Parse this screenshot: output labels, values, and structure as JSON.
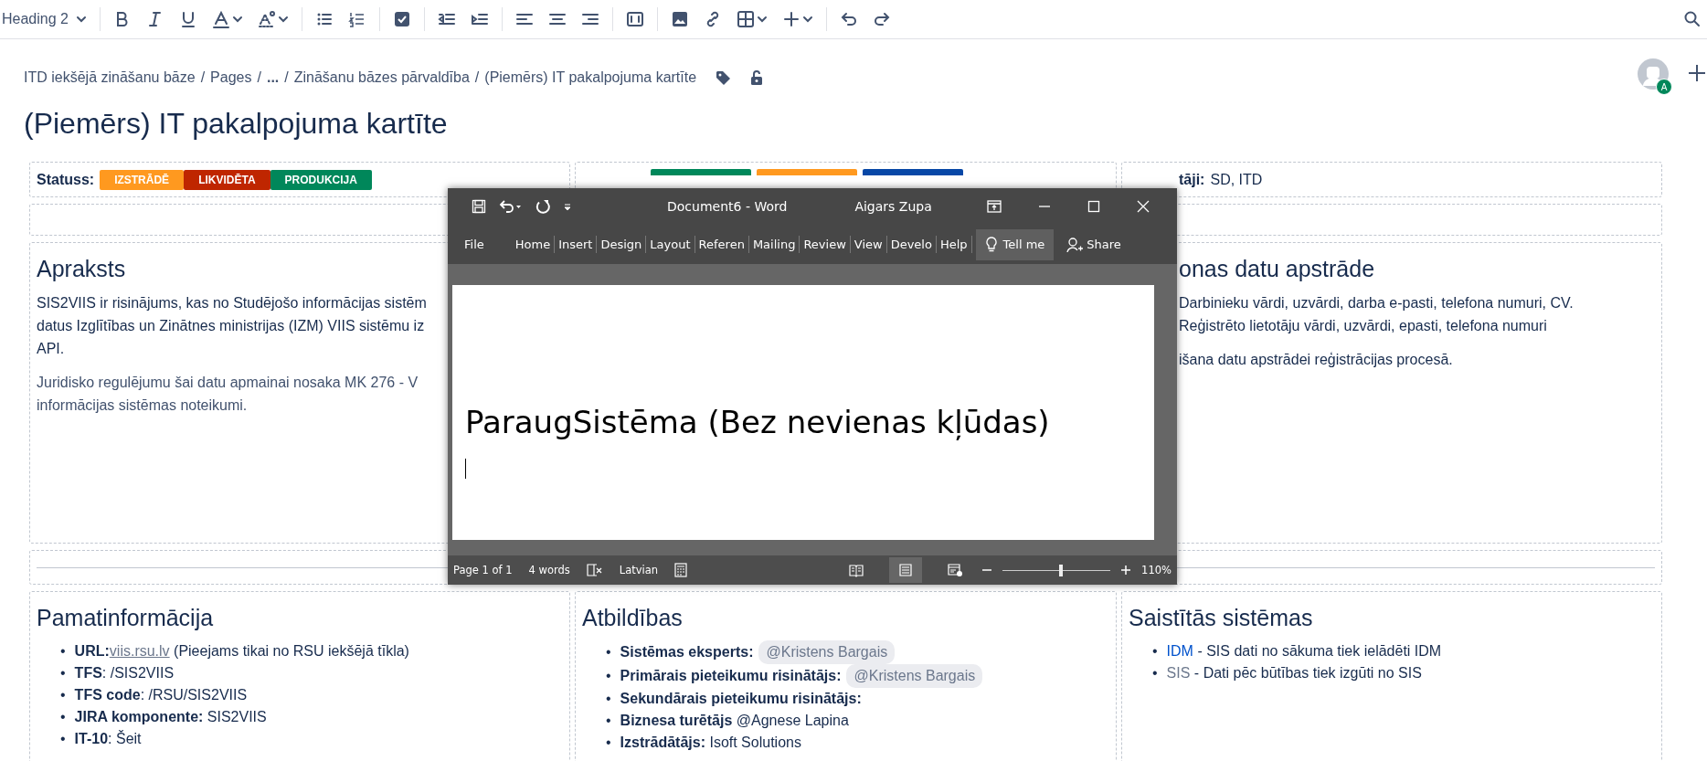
{
  "toolbar": {
    "text_style": "Heading 2",
    "items": [
      {
        "kind": "bold"
      },
      {
        "kind": "italic"
      },
      {
        "kind": "underline"
      },
      {
        "kind": "text-color"
      },
      {
        "kind": "format"
      },
      {
        "kind": "separator"
      },
      {
        "kind": "bullets"
      },
      {
        "kind": "numbers"
      },
      {
        "kind": "separator"
      },
      {
        "kind": "task"
      },
      {
        "kind": "separator"
      },
      {
        "kind": "outdent"
      },
      {
        "kind": "indent"
      },
      {
        "kind": "separator"
      },
      {
        "kind": "align-left"
      },
      {
        "kind": "align-center"
      },
      {
        "kind": "align-right"
      },
      {
        "kind": "separator"
      },
      {
        "kind": "layout"
      },
      {
        "kind": "separator"
      },
      {
        "kind": "image"
      },
      {
        "kind": "link"
      },
      {
        "kind": "table"
      },
      {
        "kind": "insert"
      },
      {
        "kind": "separator"
      },
      {
        "kind": "undo"
      },
      {
        "kind": "redo"
      }
    ]
  },
  "breadcrumb": {
    "separator": "/",
    "items": [
      "ITD iekšējā zināšanu bāze",
      "Pages",
      "...",
      "Zināšanu bāzes pārvaldība",
      "(Piemērs) IT pakalpojuma kartīte"
    ]
  },
  "avatar": {
    "badge": "A"
  },
  "title": "(Piemērs) IT pakalpojuma kartīte",
  "status_row": {
    "label": "Statuss:",
    "badges": [
      {
        "text": "IZSTRĀDĒ",
        "color": "#ff991f"
      },
      {
        "text": "LIKVIDĒTA",
        "color": "#bf2600"
      },
      {
        "text": "PRODUKCIJA",
        "color": "#00875a"
      }
    ],
    "partial_badges": [
      {
        "color": "#00875a"
      },
      {
        "color": "#ff991f"
      },
      {
        "color": "#0747a6"
      }
    ],
    "right_label": "tāji:",
    "right_value": "SD, ITD"
  },
  "description": {
    "heading": "Apraksts",
    "lines": [
      "SIS2VIIS ir risinājums, kas no Studējošo informācijas sistēm",
      "datus Izglītības un Zinātnes ministrijas (IZM) VIIS sistēmu iz",
      "API."
    ],
    "law_lines": [
      "Juridisko regulējumu šai datu apmainai nosaka MK 276 - V",
      "informācijas sistēmas noteikumi."
    ]
  },
  "data_processing": {
    "heading": "onas datu apstrāde",
    "lines": [
      "Darbinieku vārdi, uzvārdi, darba e-pasti, telefona numuri, CV.",
      "Reģistrēto lietotāju vārdi, uzvārdi, epasti, telefona numuri"
    ],
    "note": "išana datu apstrādei reģistrācijas procesā."
  },
  "bullet": "•",
  "basic_info": {
    "heading": "Pamatinformācija",
    "items": [
      {
        "label": "URL:",
        "link": "viis.rsu.lv",
        "text": " (Pieejams tikai no RSU iekšējā tīkla)"
      },
      {
        "label": "TFS",
        "text": ": /SIS2VIIS"
      },
      {
        "label": "TFS code",
        "text": ": /RSU/SIS2VIIS"
      },
      {
        "label": "JIRA komponente:",
        "text": " SIS2VIIS"
      },
      {
        "label": "IT-10",
        "text": ": Šeit"
      }
    ]
  },
  "responsibilities": {
    "heading": "Atbildības",
    "items": [
      {
        "label": "Sistēmas eksperts:",
        "mention": "@Kristens Bargais"
      },
      {
        "label": "Primārais pieteikumu risinātājs:",
        "mention": "@Kristens Bargais"
      },
      {
        "label": "Sekundārais pieteikumu risinātājs:"
      },
      {
        "label": "Biznesa turētājs",
        "text": " @Agnese Lapina"
      },
      {
        "label": "Izstrādātājs:",
        "text": " Isoft Solutions"
      }
    ]
  },
  "related_systems": {
    "heading": "Saistītās sistēmas",
    "items": [
      {
        "link": "IDM",
        "text": " - SIS dati no sākuma tiek ielādēti IDM"
      },
      {
        "link": "SIS",
        "text": " - Dati pēc būtības tiek izgūti no SIS"
      }
    ]
  },
  "word_window": {
    "title": "Document6  -  Word",
    "user": "Aigars Zupa",
    "tabs": [
      {
        "label": "File",
        "selected": false
      },
      {
        "label": "Home",
        "selected": false
      },
      {
        "label": "Insert",
        "selected": false
      },
      {
        "label": "Design",
        "selected": false
      },
      {
        "label": "Layout",
        "selected": false
      },
      {
        "label": "Referen",
        "selected": false
      },
      {
        "label": "Mailing",
        "selected": false
      },
      {
        "label": "Review",
        "selected": false
      },
      {
        "label": "View",
        "selected": false
      },
      {
        "label": "Develo",
        "selected": false
      },
      {
        "label": "Help",
        "selected": false
      }
    ],
    "tell_me": "Tell me",
    "share": "Share",
    "document_text": "ParaugSistēma (Bez nevienas kļūdas)",
    "status": {
      "page": "Page 1 of 1",
      "words": "4 words",
      "language": "Latvian",
      "zoom": "110%",
      "zoom_slider": {
        "level": 0.54
      },
      "views": [
        {
          "kind": "read",
          "selected": false
        },
        {
          "kind": "print",
          "selected": true
        },
        {
          "kind": "web",
          "selected": false
        }
      ]
    }
  }
}
